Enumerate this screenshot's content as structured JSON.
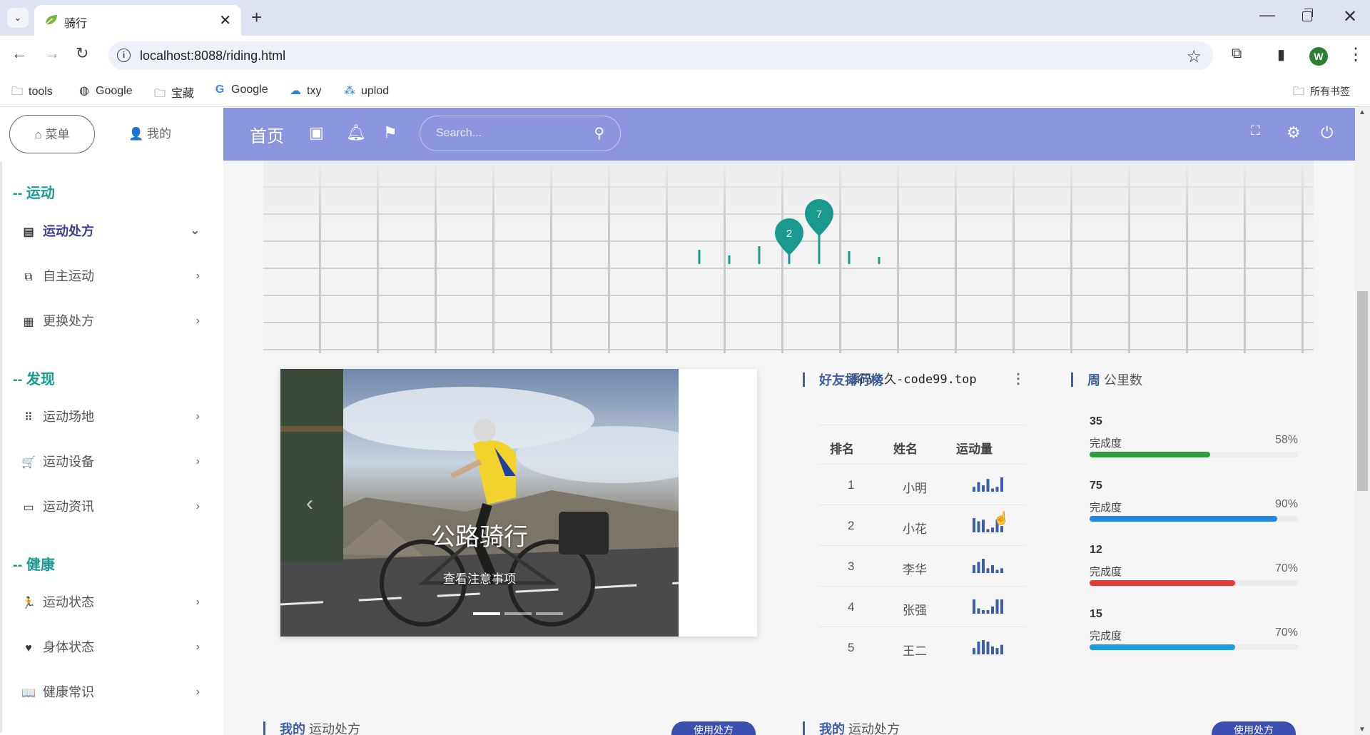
{
  "browser": {
    "tab_title": "骑行",
    "url": "localhost:8088/riding.html",
    "profile_initial": "W",
    "bookmarks": [
      {
        "label": "tools",
        "icon": "folder-icon"
      },
      {
        "label": "Google",
        "icon": "globe-icon"
      },
      {
        "label": "宝藏",
        "icon": "folder-icon"
      },
      {
        "label": "Google",
        "icon": "google-icon"
      },
      {
        "label": "txy",
        "icon": "cloud-icon"
      },
      {
        "label": "uplod",
        "icon": "cluster-icon"
      }
    ],
    "all_bookmarks": "所有书签"
  },
  "sidebar": {
    "tab_menu": "菜单",
    "tab_mine": "我的",
    "sections": [
      {
        "title": "-- 运动",
        "items": [
          {
            "label": "运动处方",
            "icon": "list-icon",
            "active": true
          },
          {
            "label": "自主运动",
            "icon": "copy-icon"
          },
          {
            "label": "更换处方",
            "icon": "calendar-icon"
          }
        ]
      },
      {
        "title": "-- 发现",
        "items": [
          {
            "label": "运动场地",
            "icon": "grid-icon"
          },
          {
            "label": "运动设备",
            "icon": "cart-icon"
          },
          {
            "label": "运动资讯",
            "icon": "monitor-icon"
          }
        ]
      },
      {
        "title": "-- 健康",
        "items": [
          {
            "label": "运动状态",
            "icon": "run-icon"
          },
          {
            "label": "身体状态",
            "icon": "heart-icon"
          },
          {
            "label": "健康常识",
            "icon": "book-icon"
          }
        ]
      }
    ]
  },
  "header": {
    "home": "首页",
    "search_placeholder": "Search..."
  },
  "map": {
    "markers": [
      "2",
      "7"
    ],
    "accent": "#1a9a8e"
  },
  "carousel": {
    "title": "公路骑行",
    "subtitle": "查看注意事项",
    "watermark": "源码久久-code99.top"
  },
  "ranking": {
    "title_strong": "好友排行榜",
    "columns": [
      "排名",
      "姓名",
      "运动量"
    ],
    "rows": [
      {
        "rank": "1",
        "name": "小明",
        "spark": [
          3,
          6,
          4,
          8,
          2,
          3,
          9
        ]
      },
      {
        "rank": "2",
        "name": "小花",
        "spark": [
          9,
          7,
          8,
          2,
          3,
          8,
          4
        ]
      },
      {
        "rank": "3",
        "name": "李华",
        "spark": [
          5,
          7,
          9,
          3,
          5,
          2,
          3
        ]
      },
      {
        "rank": "4",
        "name": "张强",
        "spark": [
          8,
          3,
          2,
          2,
          4,
          8,
          8
        ]
      },
      {
        "rank": "5",
        "name": "王二",
        "spark": [
          4,
          8,
          9,
          8,
          5,
          4,
          6
        ]
      }
    ]
  },
  "weekly": {
    "title_strong": "周",
    "title_rest": "公里数",
    "stats": [
      {
        "value": "35",
        "label": "完成度",
        "pct_text": "58%",
        "pct": 58,
        "color": "#2e9b3c"
      },
      {
        "value": "75",
        "label": "完成度",
        "pct_text": "90%",
        "pct": 90,
        "color": "#1e88e5"
      },
      {
        "value": "12",
        "label": "完成度",
        "pct_text": "70%",
        "pct": 70,
        "color": "#e53935"
      },
      {
        "value": "15",
        "label": "完成度",
        "pct_text": "70%",
        "pct": 70,
        "color": "#1e9be0"
      }
    ]
  },
  "bottom": {
    "left_strong": "我的",
    "left_rest": "运动处方",
    "right_strong": "我的",
    "right_rest": "运动处方",
    "button": "使用处方"
  }
}
